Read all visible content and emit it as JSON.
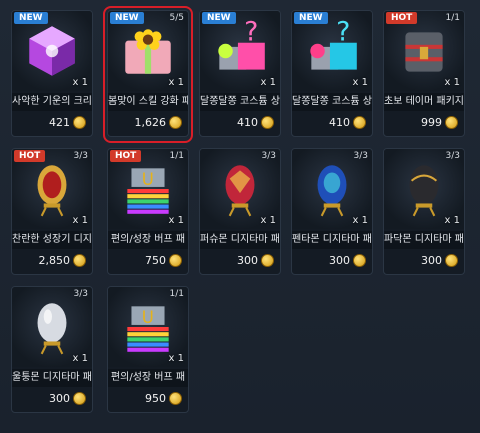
{
  "items": [
    {
      "badge": "NEW",
      "count": "",
      "qty": "x 1",
      "name": "사악한 기운의 크리",
      "price": "421",
      "icon": "purple-cube-icon"
    },
    {
      "badge": "NEW",
      "count": "5/5",
      "qty": "x 1",
      "name": "봄맞이 스킬 강화 패",
      "price": "1,626",
      "icon": "flower-box-icon"
    },
    {
      "badge": "NEW",
      "count": "",
      "qty": "x 1",
      "name": "달쫑달쫑 코스튬 상",
      "price": "410",
      "icon": "pink-mystery-box-icon"
    },
    {
      "badge": "NEW",
      "count": "",
      "qty": "x 1",
      "name": "달쫑달쫑 코스튬 상",
      "price": "410",
      "icon": "blue-mystery-box-icon"
    },
    {
      "badge": "HOT",
      "count": "1/1",
      "qty": "x 1",
      "name": "초보 테이머 패키지",
      "price": "999",
      "icon": "chest-icon"
    },
    {
      "badge": "HOT",
      "count": "3/3",
      "qty": "x 1",
      "name": "찬란한 성장기 디지",
      "price": "2,850",
      "icon": "golden-egg-icon"
    },
    {
      "badge": "HOT",
      "count": "1/1",
      "qty": "x 1",
      "name": "편의/성장 버프 패",
      "price": "750",
      "icon": "buff-pack-icon"
    },
    {
      "badge": "",
      "count": "3/3",
      "qty": "x 1",
      "name": "퍼슈몬 디지타마 패",
      "price": "300",
      "icon": "red-egg-icon"
    },
    {
      "badge": "",
      "count": "3/3",
      "qty": "x 1",
      "name": "펜타몬 디지타마 패",
      "price": "300",
      "icon": "blue-egg-icon"
    },
    {
      "badge": "",
      "count": "3/3",
      "qty": "x 1",
      "name": "파닥몬 디지타마 패",
      "price": "300",
      "icon": "black-egg-icon"
    },
    {
      "badge": "",
      "count": "3/3",
      "qty": "x 1",
      "name": "울퉁몬 디지타마 패",
      "price": "300",
      "icon": "silver-egg-icon"
    },
    {
      "badge": "",
      "count": "1/1",
      "qty": "x 1",
      "name": "편의/성장 버프 패",
      "price": "950",
      "icon": "buff-pack-icon"
    }
  ],
  "colors": {
    "selected": "#d81e28",
    "new": "#2a7fd4",
    "hot": "#d23a2a"
  }
}
